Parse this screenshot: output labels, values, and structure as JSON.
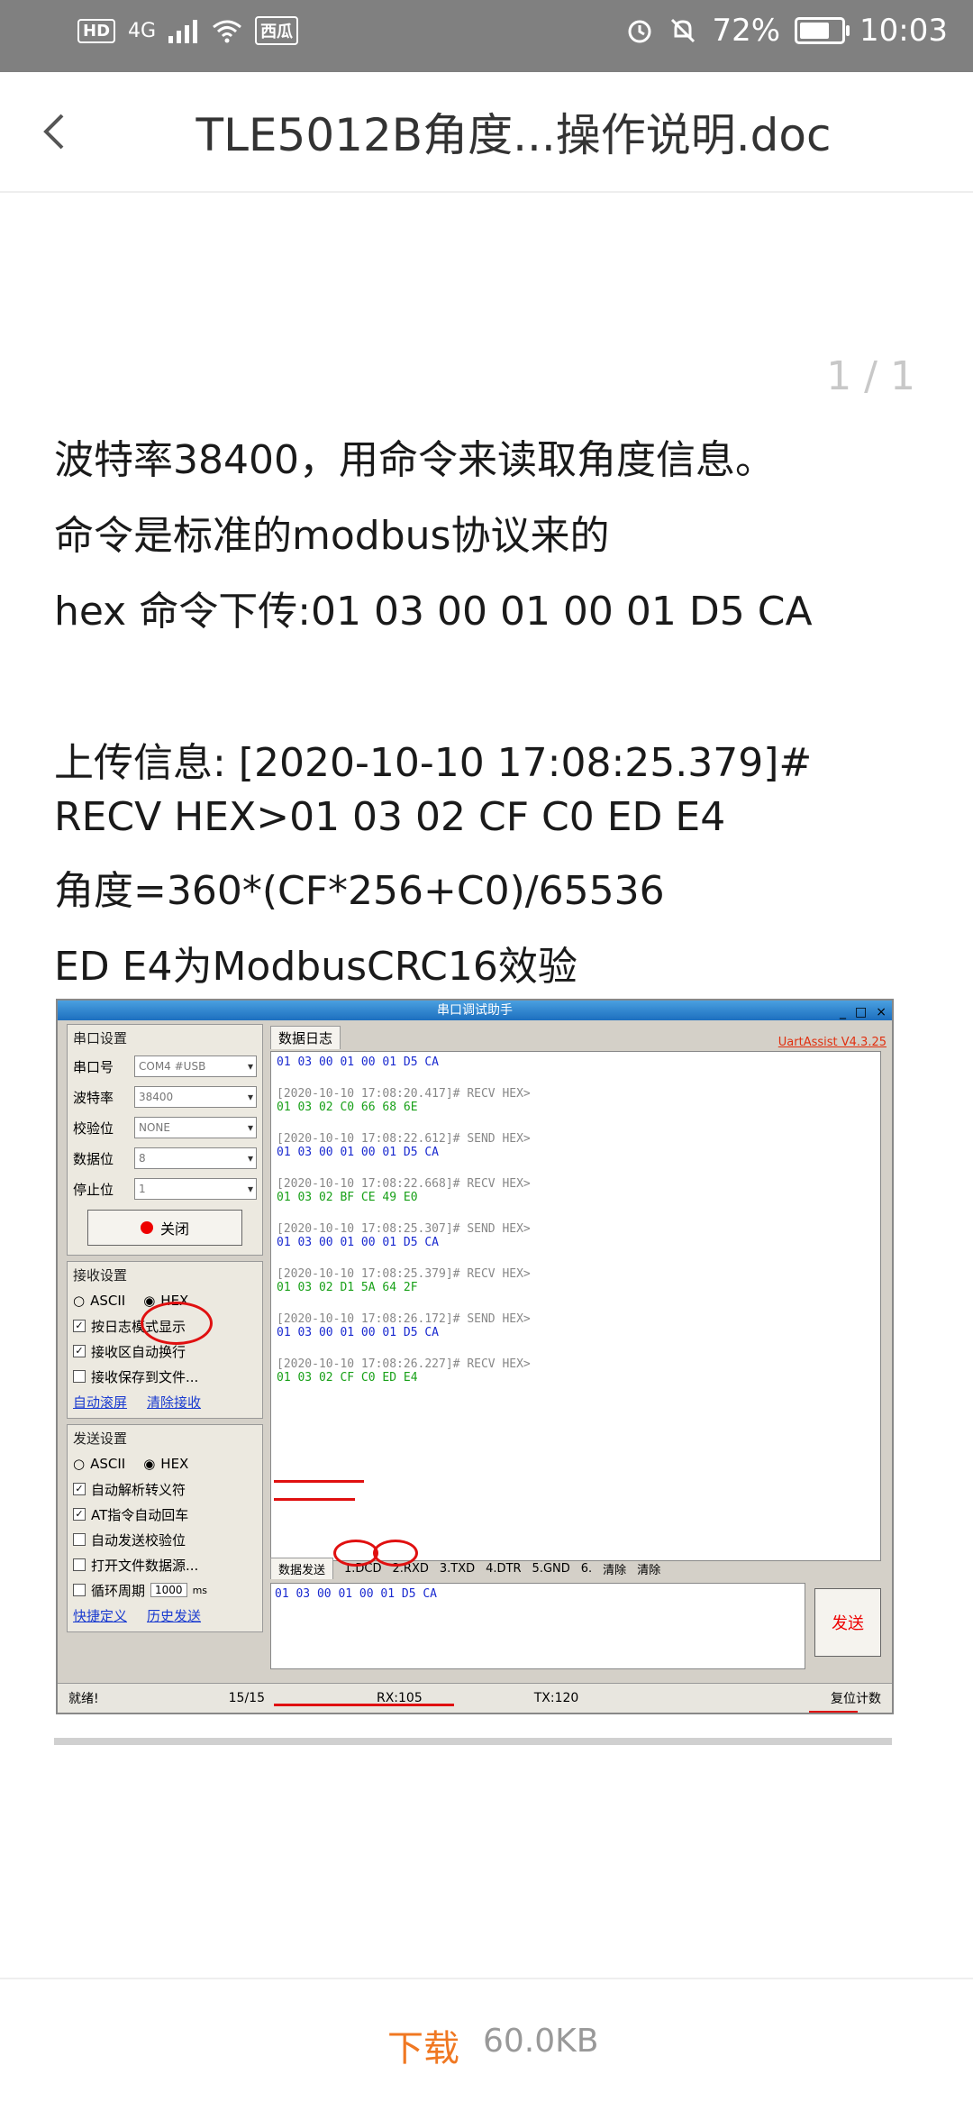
{
  "status_bar": {
    "network_badges": [
      "HD",
      "4G"
    ],
    "carrier_badge": "西瓜",
    "battery_percent": "72%",
    "time": "10:03",
    "battery_level": 0.72
  },
  "header": {
    "title": "TLE5012B角度...操作说明.doc"
  },
  "pager": "1 / 1",
  "document": {
    "line1": "波特率38400，用命令来读取角度信息。",
    "line2": "命令是标准的modbus协议来的",
    "line3": "hex 命令下传:01 03 00 01 00 01 D5 CA",
    "line4": "上传信息: [2020-10-10 17:08:25.379]#",
    "line5": "RECV HEX>01 03 02 CF C0 ED E4",
    "line6": "角度=360*(CF*256+C0)/65536",
    "line7": "ED E4为ModbusCRC16效验"
  },
  "embedded_screenshot": {
    "window_title": "串口调试助手",
    "version": "UartAssist V4.3.25",
    "serial_group_title": "串口设置",
    "port_label": "串口号",
    "port_value": "COM4 #USB",
    "baud_label": "波特率",
    "baud_value": "38400",
    "parity_label": "校验位",
    "parity_value": "NONE",
    "databits_label": "数据位",
    "databits_value": "8",
    "stopbits_label": "停止位",
    "stopbits_value": "1",
    "close_label": "关闭",
    "recv_group_title": "接收设置",
    "ascii_label": "ASCII",
    "hex_label": "HEX",
    "log_mode_label": "按日志模式显示",
    "auto_wrap_label": "接收区自动换行",
    "save_file_label": "接收保存到文件...",
    "auto_scroll_link": "自动滚屏",
    "clear_recv_link": "清除接收",
    "send_group_title": "发送设置",
    "parse_escape_label": "自动解析转义符",
    "at_return_label": "AT指令自动回车",
    "auto_checksum_label": "自动发送校验位",
    "file_source_label": "打开文件数据源...",
    "loop_label": "循环周期",
    "loop_value": "1000",
    "loop_unit": "ms",
    "shortcut_link": "快捷定义",
    "history_link": "历史发送",
    "log_tab": "数据日志",
    "log": [
      {
        "type": "send",
        "text": "01 03 00 01 00 01 D5 CA"
      },
      {
        "type": "hdr",
        "text": "[2020-10-10 17:08:20.417]# RECV HEX>"
      },
      {
        "type": "recv",
        "text": "01 03 02 C0 66 68 6E"
      },
      {
        "type": "hdr",
        "text": "[2020-10-10 17:08:22.612]# SEND HEX>"
      },
      {
        "type": "send",
        "text": "01 03 00 01 00 01 D5 CA"
      },
      {
        "type": "hdr",
        "text": "[2020-10-10 17:08:22.668]# RECV HEX>"
      },
      {
        "type": "recv",
        "text": "01 03 02 BF CE 49 E0"
      },
      {
        "type": "hdr",
        "text": "[2020-10-10 17:08:25.307]# SEND HEX>"
      },
      {
        "type": "send",
        "text": "01 03 00 01 00 01 D5 CA"
      },
      {
        "type": "hdr",
        "text": "[2020-10-10 17:08:25.379]# RECV HEX>"
      },
      {
        "type": "recv",
        "text": "01 03 02 D1 5A 64 2F"
      },
      {
        "type": "hdr",
        "text": "[2020-10-10 17:08:26.172]# SEND HEX>"
      },
      {
        "type": "send",
        "text": "01 03 00 01 00 01 D5 CA"
      },
      {
        "type": "hdr",
        "text": "[2020-10-10 17:08:26.227]# RECV HEX>"
      },
      {
        "type": "recv",
        "text": "01 03 02 CF C0 ED E4"
      }
    ],
    "send_tab": "数据发送",
    "pins": [
      "1.DCD",
      "2.RXD",
      "3.TXD",
      "4.DTR",
      "5.GND",
      "6."
    ],
    "clear_label": "清除",
    "clear2_label": "清除",
    "send_input": "01 03 00 01 00 01 D5 CA",
    "send_button": "发送",
    "status_ready": "就绪!",
    "status_count": "15/15",
    "status_rx": "RX:105",
    "status_tx": "TX:120",
    "reset_count": "复位计数"
  },
  "footer": {
    "download_label": "下载",
    "file_size": "60.0KB"
  },
  "colors": {
    "status_bar_bg": "#808080",
    "download_accent": "#f07822",
    "send_text": "#1a2ad0",
    "recv_text": "#18a018",
    "annotation_red": "#e01010"
  }
}
